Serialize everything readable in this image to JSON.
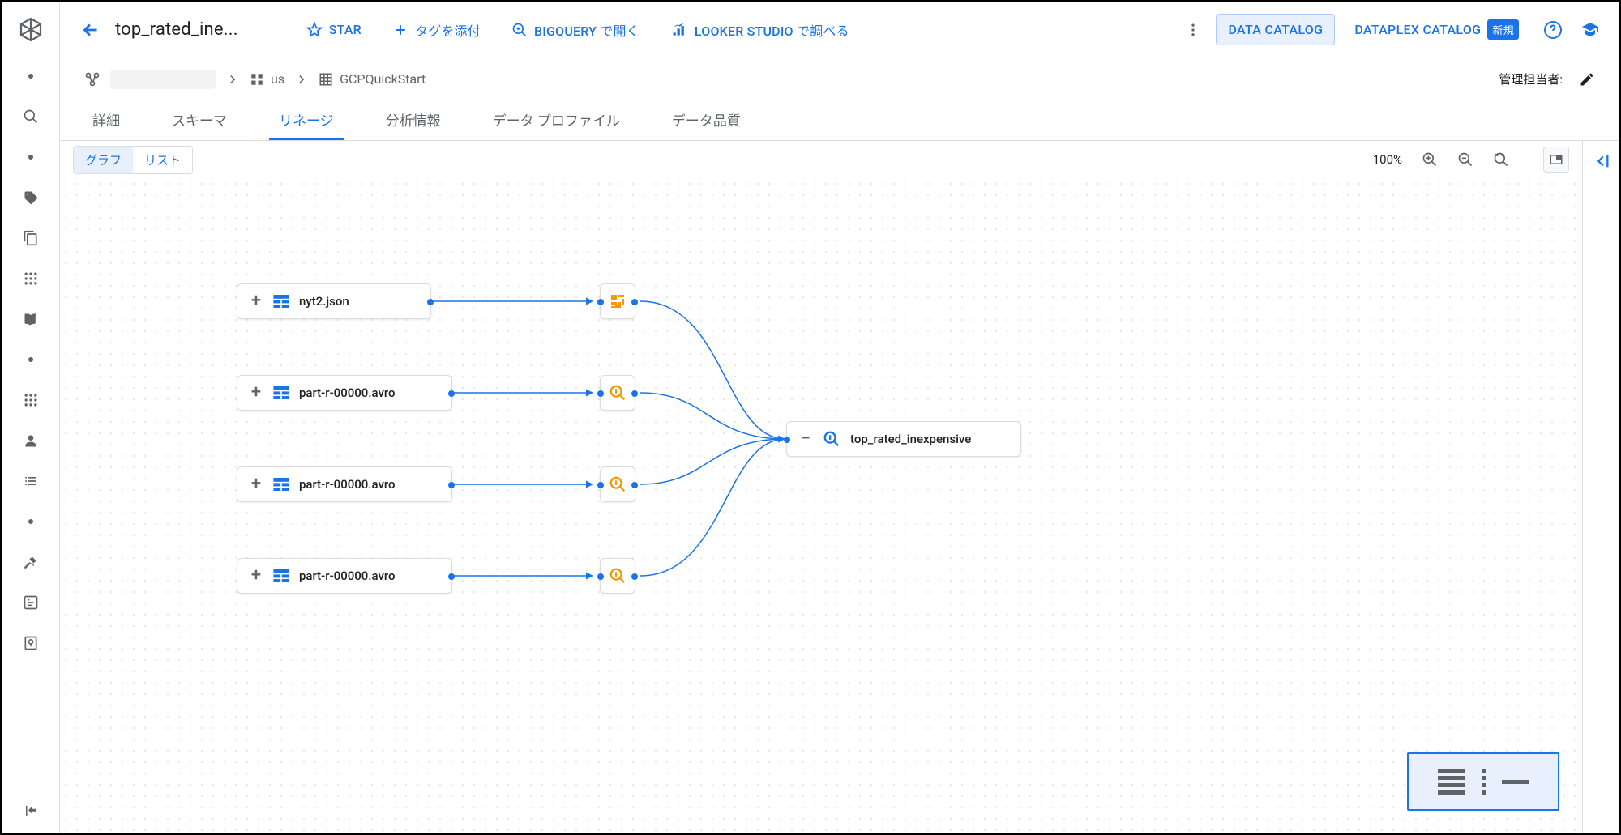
{
  "header": {
    "title": "top_rated_ine...",
    "actions": {
      "star": "STAR",
      "tag": "タグを添付",
      "bigquery": "BIGQUERY で開く",
      "looker": "LOOKER STUDIO で調べる"
    },
    "catalogs": {
      "data_catalog": "DATA CATALOG",
      "dataplex_catalog": "DATAPLEX CATALOG",
      "new_badge": "新規"
    }
  },
  "breadcrumb": {
    "region": "us",
    "project": "GCPQuickStart",
    "owner_label": "管理担当者:"
  },
  "tabs": {
    "details": "詳細",
    "schema": "スキーマ",
    "lineage": "リネージ",
    "analysis": "分析情報",
    "profile": "データ プロファイル",
    "quality": "データ品質"
  },
  "toolbar": {
    "view_graph": "グラフ",
    "view_list": "リスト",
    "zoom": "100%"
  },
  "graph": {
    "sources": [
      {
        "label": "nyt2.json"
      },
      {
        "label": "part-r-00000.avro"
      },
      {
        "label": "part-r-00000.avro"
      },
      {
        "label": "part-r-00000.avro"
      }
    ],
    "target": {
      "label": "top_rated_inexpensive"
    }
  }
}
